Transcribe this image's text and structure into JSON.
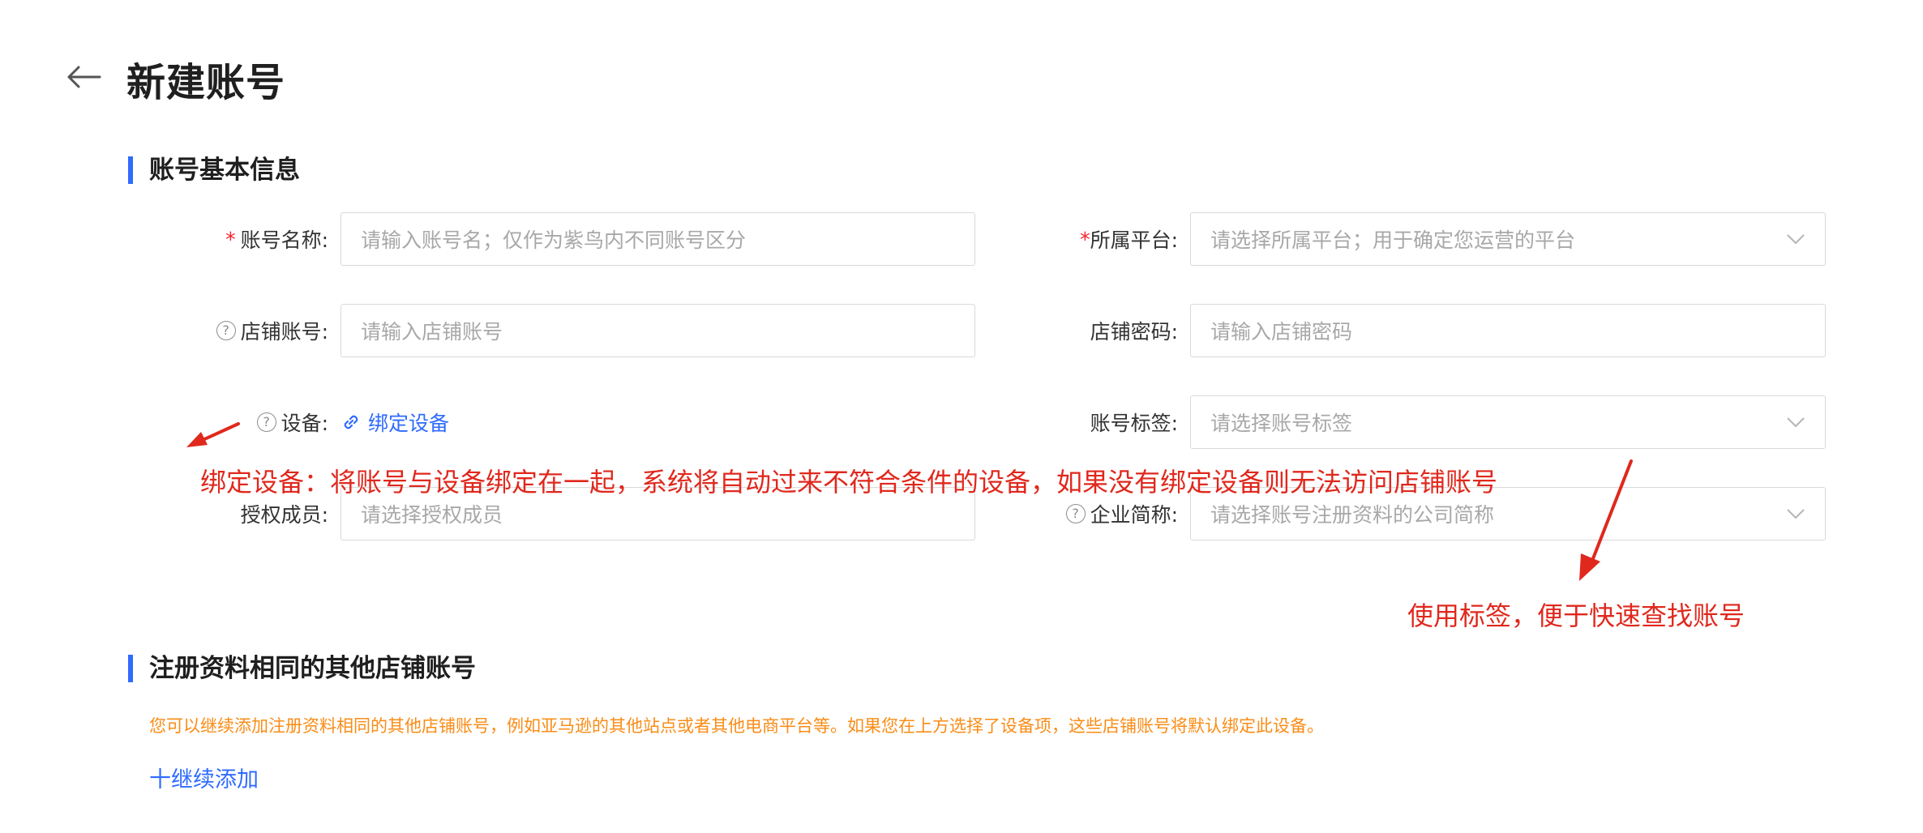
{
  "page": {
    "title": "新建账号"
  },
  "sections": {
    "basic": "账号基本信息",
    "others": "注册资料相同的其他店铺账号"
  },
  "fields": {
    "account_name": {
      "required": "*",
      "label": "账号名称:",
      "placeholder": "请输入账号名；仅作为紫鸟内不同账号区分"
    },
    "platform": {
      "required": "*",
      "label": "所属平台:",
      "placeholder": "请选择所属平台；用于确定您运营的平台"
    },
    "store_account": {
      "label": "店铺账号:",
      "placeholder": "请输入店铺账号"
    },
    "store_password": {
      "label": "店铺密码:",
      "placeholder": "请输入店铺密码"
    },
    "device": {
      "label": "设备:",
      "link": "绑定设备"
    },
    "tags": {
      "label": "账号标签:",
      "placeholder": "请选择账号标签"
    },
    "members": {
      "label": "授权成员:",
      "placeholder": "请选择授权成员"
    },
    "company": {
      "label": "企业简称:",
      "placeholder": "请选择账号注册资料的公司简称"
    }
  },
  "annotations": {
    "device_note": "绑定设备：将账号与设备绑定在一起，系统将自动过来不符合条件的设备，如果没有绑定设备则无法访问店铺账号",
    "tag_note": "使用标签，便于快速查找账号"
  },
  "others": {
    "tip": "您可以继续添加注册资料相同的其他店铺账号，例如亚马逊的其他站点或者其他电商平台等。如果您在上方选择了设备项，这些店铺账号将默认绑定此设备。",
    "add_label": "十继续添加"
  },
  "colors": {
    "accent": "#2f6bff",
    "annotation": "#e0281d",
    "tip": "#fa8c16"
  },
  "icons": [
    "arrow-left-icon",
    "help-circle-icon",
    "link-icon",
    "chevron-down-icon"
  ]
}
